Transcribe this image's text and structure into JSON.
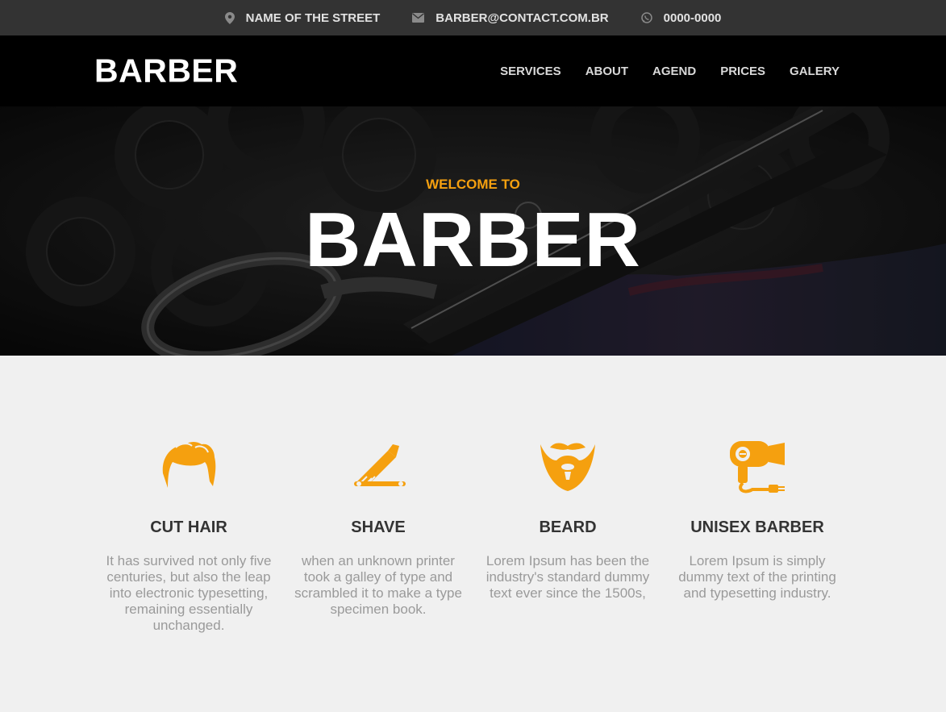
{
  "topbar": {
    "address": "NAME OF THE STREET",
    "email": "BARBER@CONTACT.COM.BR",
    "phone": "0000-0000"
  },
  "nav": {
    "logo": "BARBER",
    "items": [
      "SERVICES",
      "ABOUT",
      "AGEND",
      "PRICES",
      "GALERY"
    ]
  },
  "hero": {
    "welcome": "WELCOME TO",
    "title": "BARBER"
  },
  "services": [
    {
      "title": "CUT HAIR",
      "text": "It has survived not only five centuries, but also the leap into electronic typesetting, remaining essentially unchanged.",
      "icon": "hair-icon"
    },
    {
      "title": "SHAVE",
      "text": "when an unknown printer took a galley of type and scrambled it to make a type specimen book.",
      "icon": "razor-icon"
    },
    {
      "title": "BEARD",
      "text": "Lorem Ipsum has been the industry's standard dummy text ever since the 1500s,",
      "icon": "beard-icon"
    },
    {
      "title": "UNISEX BARBER",
      "text": "Lorem Ipsum is simply dummy text of the printing and typesetting industry.",
      "icon": "hair-dryer-icon"
    }
  ],
  "colors": {
    "accent": "#f5a00f",
    "topbar": "#333333",
    "nav": "#000000",
    "section": "#f0f0f0"
  }
}
